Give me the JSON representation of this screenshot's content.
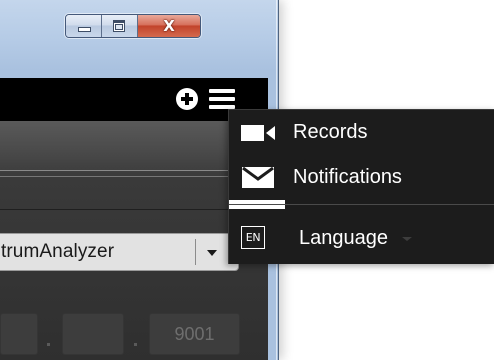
{
  "window": {
    "caption_buttons": {
      "minimize": "minimize",
      "maximize": "maximize",
      "close_glyph": "X"
    }
  },
  "toolbar": {
    "add_icon": "plus-circle-icon",
    "menu_icon": "hamburger-menu-icon"
  },
  "device_select": {
    "value": "trumAnalyzer"
  },
  "fields": {
    "port": "9001"
  },
  "menu": {
    "items": [
      {
        "label": "Records",
        "icon": "video-camera-icon"
      },
      {
        "label": "Notifications",
        "icon": "envelope-icon"
      },
      {
        "label": "Language",
        "icon": "language-icon",
        "icon_text": "EN"
      }
    ]
  },
  "colors": {
    "menu_background": "#1c1c1c",
    "toolbar_background": "#000000",
    "close_button": "#c2432b",
    "window_frame": "#b5cbe6"
  }
}
